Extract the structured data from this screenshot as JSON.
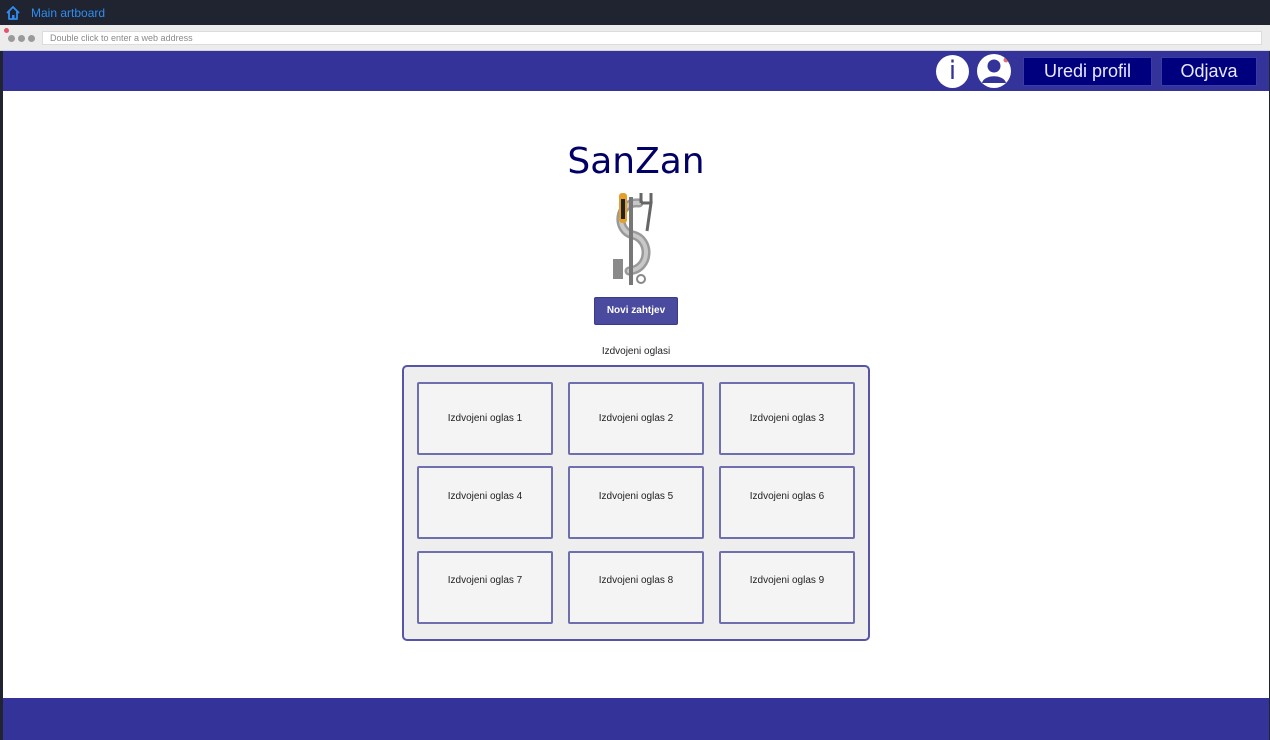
{
  "app": {
    "title": "Main artboard"
  },
  "browser": {
    "address_placeholder": "Double click to enter a web address"
  },
  "navbar": {
    "info_label": "i",
    "edit_profile_label": "Uredi profil",
    "logout_label": "Odjava"
  },
  "brand": {
    "name": "SanZan"
  },
  "actions": {
    "new_request_label": "Novi zahtjev"
  },
  "featured": {
    "heading": "Izdvojeni oglasi",
    "items": [
      {
        "label": "Izdvojeni oglas 1"
      },
      {
        "label": "Izdvojeni oglas 2"
      },
      {
        "label": "Izdvojeni oglas 3"
      },
      {
        "label": "Izdvojeni oglas 4"
      },
      {
        "label": "Izdvojeni oglas 5"
      },
      {
        "label": "Izdvojeni oglas 6"
      },
      {
        "label": "Izdvojeni oglas 7"
      },
      {
        "label": "Izdvojeni oglas 8"
      },
      {
        "label": "Izdvojeni oglas 9"
      }
    ]
  },
  "colors": {
    "primary": "#333399",
    "button_dark": "#00007f",
    "brand_text": "#000066",
    "accent_button": "#4a4a9e",
    "card_border": "#6f6fb0"
  },
  "icons": {
    "home": "home-icon",
    "info": "info-icon",
    "user": "user-icon",
    "logo": "plumbing-logo-icon"
  }
}
